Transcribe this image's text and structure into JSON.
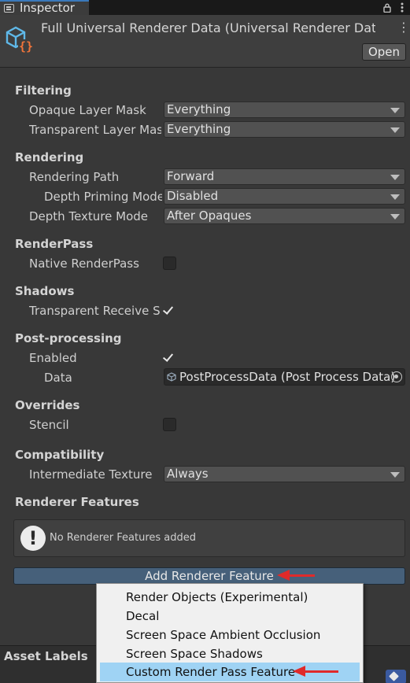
{
  "tab": {
    "label": "Inspector"
  },
  "header": {
    "title": "Full Universal Renderer Data (Universal Renderer Data)",
    "open_label": "Open"
  },
  "sections": {
    "filtering": "Filtering",
    "rendering": "Rendering",
    "renderpass": "RenderPass",
    "shadows": "Shadows",
    "postprocessing": "Post-processing",
    "overrides": "Overrides",
    "compatibility": "Compatibility",
    "renderer_features": "Renderer Features"
  },
  "fields": {
    "opaque_layer_mask": {
      "label": "Opaque Layer Mask",
      "value": "Everything"
    },
    "transparent_layer_mask": {
      "label": "Transparent Layer Mask",
      "value": "Everything"
    },
    "rendering_path": {
      "label": "Rendering Path",
      "value": "Forward"
    },
    "depth_priming_mode": {
      "label": "Depth Priming Mode",
      "value": "Disabled"
    },
    "depth_texture_mode": {
      "label": "Depth Texture Mode",
      "value": "After Opaques"
    },
    "native_renderpass": {
      "label": "Native RenderPass",
      "checked": false
    },
    "transparent_receive_shadows": {
      "label": "Transparent Receive Shadows",
      "checked": true
    },
    "post_enabled": {
      "label": "Enabled",
      "checked": true
    },
    "post_data": {
      "label": "Data",
      "value": "PostProcessData (Post Process Data)"
    },
    "stencil": {
      "label": "Stencil",
      "checked": false
    },
    "intermediate_texture": {
      "label": "Intermediate Texture",
      "value": "Always"
    }
  },
  "renderer_features": {
    "empty_message": "No Renderer Features added",
    "add_label": "Add Renderer Feature"
  },
  "add_menu": {
    "items": [
      "Render Objects (Experimental)",
      "Decal",
      "Screen Space Ambient Occlusion",
      "Screen Space Shadows",
      "Custom Render Pass Feature"
    ],
    "highlighted": "Custom Render Pass Feature"
  },
  "asset_labels": {
    "title": "Asset Labels"
  },
  "colors": {
    "background": "#383838",
    "accent_button": "#46607a",
    "menu_highlight": "#9fd3f4",
    "annotation_arrow": "#e02a2a"
  },
  "icons": {
    "tab": "inspector-icon",
    "asset": "universal-renderer-data-icon",
    "lock": "lock-icon",
    "menu": "kebab-menu-icon",
    "object_picker": "object-picker-icon",
    "warning": "warning-icon",
    "label_tag": "tag-icon"
  }
}
